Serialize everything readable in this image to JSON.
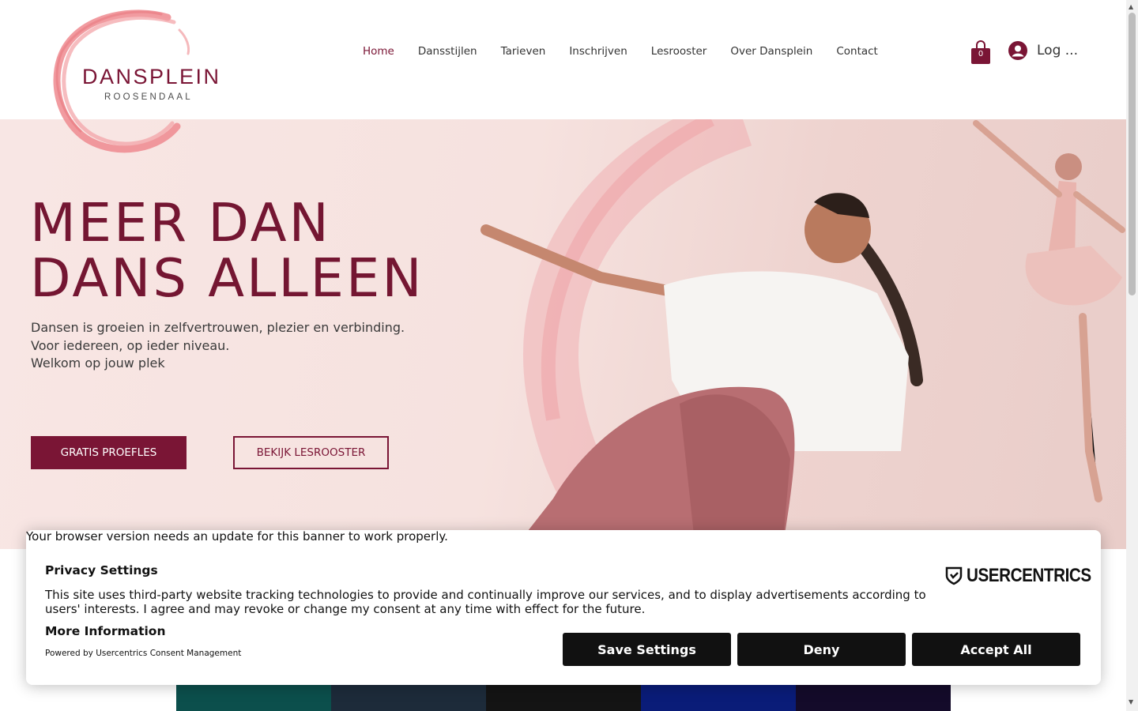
{
  "header": {
    "logo_name": "DANSPLEIN",
    "logo_sub": "ROOSENDAAL",
    "nav": [
      {
        "label": "Home"
      },
      {
        "label": "Dansstijlen"
      },
      {
        "label": "Tarieven"
      },
      {
        "label": "Inschrijven"
      },
      {
        "label": "Lesrooster"
      },
      {
        "label": "Over Dansplein"
      },
      {
        "label": "Contact"
      }
    ],
    "cart_count": "0",
    "login_label": "Log ..."
  },
  "hero": {
    "title_line1": "MEER DAN",
    "title_line2": "DANS ALLEEN",
    "text_line1": "Dansen is groeien in zelfvertrouwen, plezier en verbinding.",
    "text_line2": "Voor iedereen, op ieder niveau.",
    "text_line3": "Welkom op jouw plek",
    "primary_button": "GRATIS PROEFLES",
    "secondary_button": "BEKIJK LESROOSTER"
  },
  "consent": {
    "browser_warning": "Your browser version needs an update for this banner to work properly.",
    "title": "Privacy Settings",
    "body": "This site uses third-party website tracking technologies to provide and continually improve our services, and to display advertisements according to users' interests. I agree and may revoke or change my consent at any time with effect for the future.",
    "more_info": "More Information",
    "powered_by": "Powered by Usercentrics Consent Management",
    "brand": "USERCENTRICS",
    "save_label": "Save Settings",
    "deny_label": "Deny",
    "accept_label": "Accept All"
  },
  "colors": {
    "brand": "#7a1535",
    "accent_pink": "#ee8a8f",
    "banner_button": "#111111"
  },
  "icons": [
    "cart-icon",
    "user-avatar-icon",
    "usercentrics-shield-icon",
    "scroll-up-arrow",
    "scroll-down-arrow"
  ]
}
